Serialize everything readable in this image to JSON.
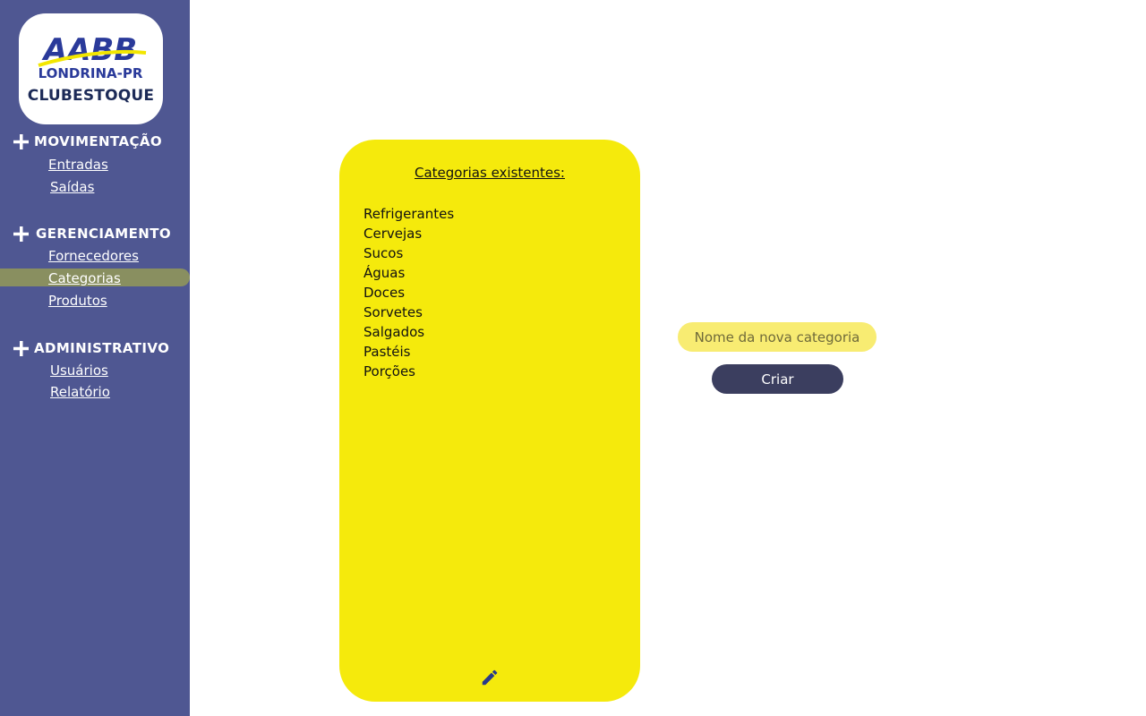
{
  "brand": {
    "logo_letters": "AABB",
    "logo_city": "LONDRINA-PR",
    "app_name": "CLUBESTOQUE"
  },
  "sidebar": {
    "sections": [
      {
        "title": "MOVIMENTAÇÃO",
        "items": [
          {
            "label": "Entradas"
          },
          {
            "label": "Saídas"
          }
        ]
      },
      {
        "title": "GERENCIAMENTO",
        "items": [
          {
            "label": "Fornecedores"
          },
          {
            "label": "Categorias",
            "active": true
          },
          {
            "label": "Produtos"
          }
        ]
      },
      {
        "title": "ADMINISTRATIVO",
        "items": [
          {
            "label": "Usuários"
          },
          {
            "label": "Relatório"
          }
        ]
      }
    ]
  },
  "categories_panel": {
    "title": "Categorias existentes:",
    "items": [
      "Refrigerantes",
      "Cervejas",
      "Sucos",
      "Águas",
      "Doces",
      "Sorvetes",
      "Salgados",
      "Pastéis",
      "Porções"
    ],
    "edit_icon": "pencil-icon"
  },
  "new_category": {
    "placeholder": "Nome da nova categoria",
    "value": "",
    "button_label": "Criar"
  },
  "colors": {
    "sidebar": "#4f5792",
    "active_item": "#898f60",
    "panel": "#f5ea0c",
    "input": "#f8ec72",
    "button": "#3b3e5f",
    "brand_text": "#1c2a57"
  }
}
